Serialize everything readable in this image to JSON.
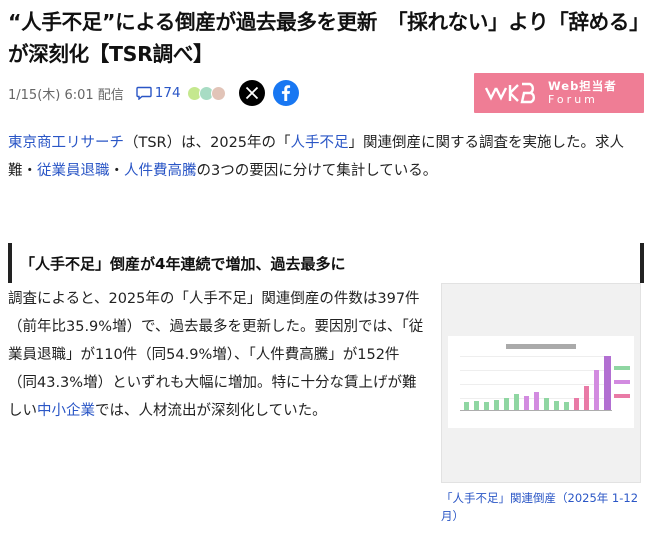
{
  "article": {
    "title": "“人手不足”による倒産が過去最多を更新　「採れない」より「辞める」が深刻化【TSR調べ】",
    "date": "1/15(木) 6:01 配信",
    "comment_count": "174"
  },
  "sponsor": {
    "line1": "Web担当者",
    "line2": "Forum"
  },
  "intro": {
    "link_tsr": "東京商工リサーチ",
    "t1": "（TSR）は、2025年の「",
    "link_shortage": "人手不足",
    "t2": "」関連倒産に関する調査を実施した。求人難・",
    "link_resign": "従業員退職",
    "t3": "・",
    "link_labor_cost": "人件費高騰",
    "t4": "の3つの要因に分けて集計している。"
  },
  "section": {
    "heading": "「人手不足」倒産が4年連続で増加、過去最多に"
  },
  "body": {
    "t1": "調査によると、2025年の「人手不足」関連倒産の件数は397件（前年比35.9%増）で、過去最多を更新した。要因別では、「従業員退職」が110件（同54.9%増）、「人件費高騰」が152件（同43.3%増）といずれも大幅に増加。特に十分な賃上げが難しい",
    "link_sme": "中小企業",
    "t2": "では、人材流出が深刻化していた。"
  },
  "figure": {
    "caption": "「人手不足」関連倒産（2025年 1-12月）"
  },
  "colors": {
    "link": "#2a56c6",
    "sponsor_bg": "#ef7d95",
    "x_bg": "#000000",
    "facebook": "#1877f2"
  },
  "icons": {
    "comment": "comment-bubble-icon",
    "x": "x-logo-icon",
    "facebook": "facebook-logo-icon"
  }
}
